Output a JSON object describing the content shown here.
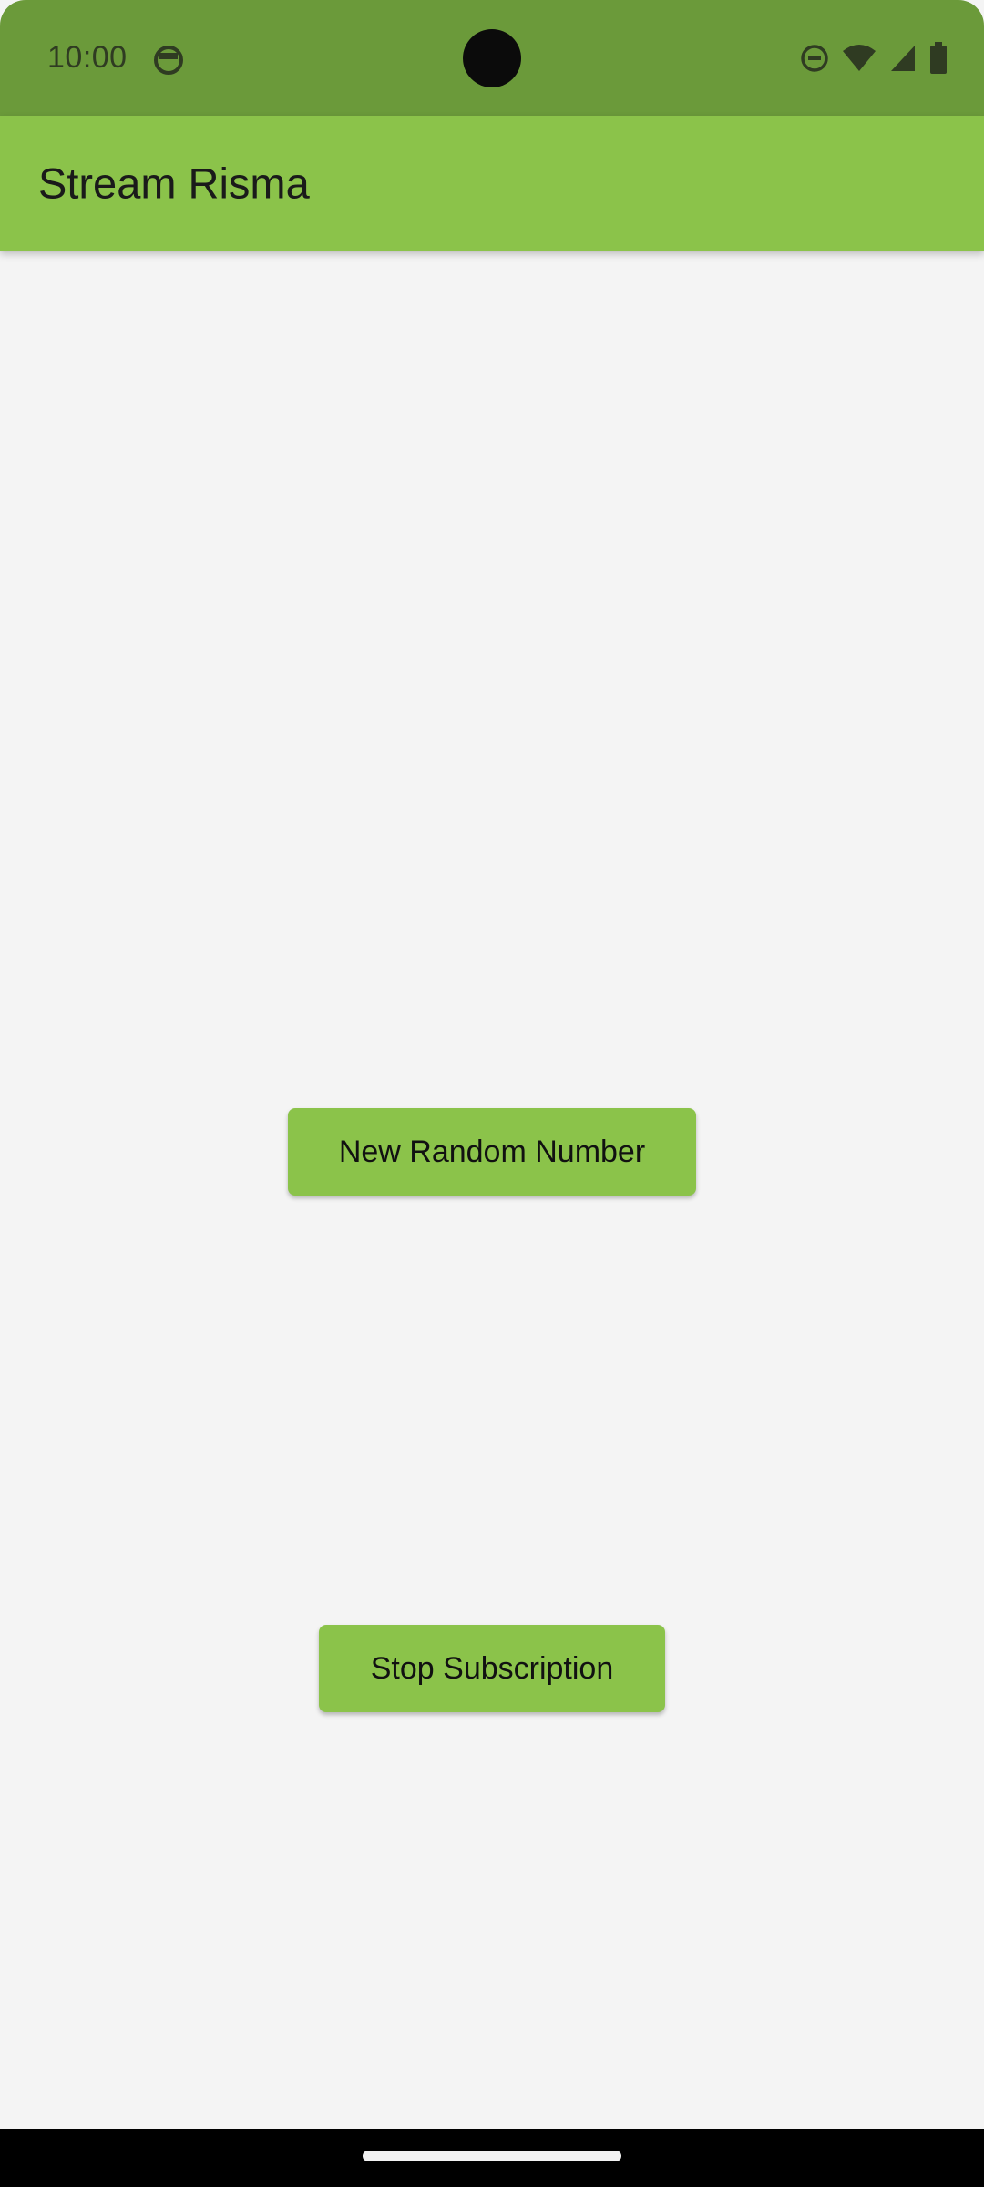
{
  "status_bar": {
    "time": "10:00",
    "icons": [
      "app-notification-icon",
      "do-not-disturb-icon",
      "wifi-icon",
      "cell-signal-icon",
      "battery-icon"
    ]
  },
  "app_bar": {
    "title": "Stream Risma"
  },
  "main": {
    "random_button_label": "New Random Number",
    "stop_button_label": "Stop Subscription"
  },
  "colors": {
    "primary": "#8bc34a",
    "status_bar": "#6b9a3a",
    "background": "#f4f4f4"
  }
}
